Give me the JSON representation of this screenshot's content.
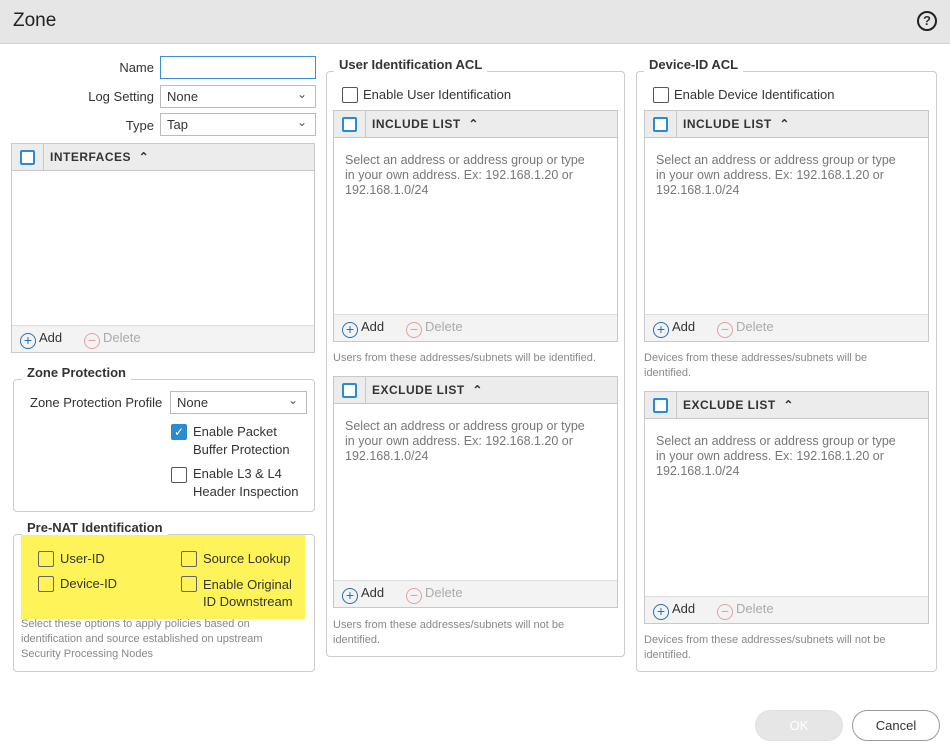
{
  "dialog": {
    "title": "Zone",
    "help": "?"
  },
  "form": {
    "name_label": "Name",
    "name_value": "",
    "log_label": "Log Setting",
    "log_value": "None",
    "type_label": "Type",
    "type_value": "Tap"
  },
  "interfaces": {
    "header": "INTERFACES",
    "add": "Add",
    "delete": "Delete"
  },
  "zone_protection": {
    "legend": "Zone Protection",
    "profile_label": "Zone Protection Profile",
    "profile_value": "None",
    "packet_buffer_1": "Enable Packet",
    "packet_buffer_2": "Buffer Protection",
    "packet_buffer_checked": true,
    "l3l4_1": "Enable L3 & L4",
    "l3l4_2": "Header Inspection",
    "l3l4_checked": false
  },
  "prenat": {
    "legend": "Pre-NAT Identification",
    "user_id": "User-ID",
    "device_id": "Device-ID",
    "source_lookup": "Source Lookup",
    "orig_1": "Enable Original",
    "orig_2": "ID Downstream",
    "help_1": "Select these options to apply policies based on",
    "help_2": "identification and source established on upstream",
    "help_3": "Security Processing Nodes"
  },
  "user_acl": {
    "legend": "User Identification ACL",
    "enable": "Enable User Identification",
    "include": "INCLUDE LIST",
    "exclude": "EXCLUDE LIST",
    "placeholder_1": "Select an address or address group or type",
    "placeholder_2": "in your own address. Ex: 192.168.1.20 or",
    "placeholder_3": "192.168.1.0/24",
    "add": "Add",
    "delete": "Delete",
    "include_note": "Users from these addresses/subnets will be identified.",
    "exclude_note_1": "Users from these addresses/subnets will not be",
    "exclude_note_2": "identified."
  },
  "device_acl": {
    "legend": "Device-ID ACL",
    "enable": "Enable Device Identification",
    "include": "INCLUDE LIST",
    "exclude": "EXCLUDE LIST",
    "placeholder_1": "Select an address or address group or type",
    "placeholder_2": "in your own address. Ex: 192.168.1.20 or",
    "placeholder_3": "192.168.1.0/24",
    "add": "Add",
    "delete": "Delete",
    "include_note_1": "Devices from these addresses/subnets will be",
    "include_note_2": "identified.",
    "exclude_note_1": "Devices from these addresses/subnets will not be",
    "exclude_note_2": "identified."
  },
  "buttons": {
    "ok": "OK",
    "cancel": "Cancel"
  }
}
